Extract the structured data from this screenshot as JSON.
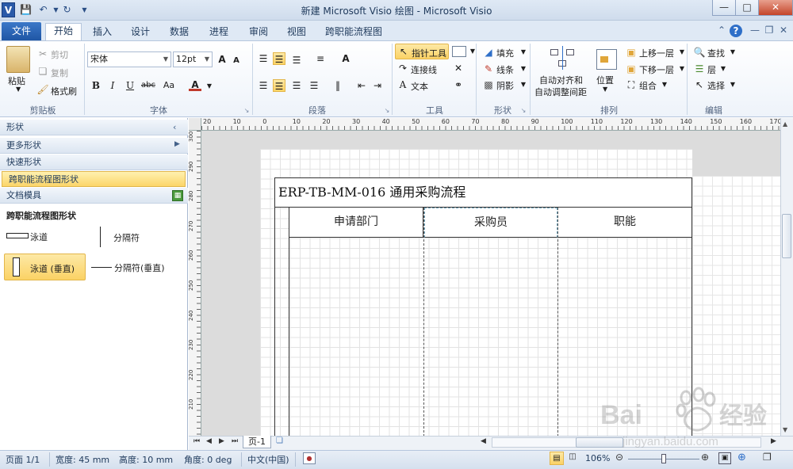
{
  "window": {
    "title": "新建 Microsoft Visio 绘图 - Microsoft Visio",
    "app_icon": "V"
  },
  "tabs": {
    "file": "文件",
    "items": [
      "开始",
      "插入",
      "设计",
      "数据",
      "进程",
      "审阅",
      "视图",
      "跨职能流程图"
    ],
    "active": "开始"
  },
  "ribbon": {
    "clipboard": {
      "label": "剪贴板",
      "paste": "粘贴",
      "cut": "剪切",
      "copy": "复制",
      "format_painter": "格式刷"
    },
    "font": {
      "label": "字体",
      "family": "宋体",
      "size": "12pt",
      "bold": "B",
      "italic": "I",
      "underline": "U",
      "strike": "abc",
      "case": "Aa",
      "color_glyph": "A"
    },
    "paragraph": {
      "label": "段落"
    },
    "tools": {
      "label": "工具",
      "pointer": "指针工具",
      "connector": "连接线",
      "text": "文本"
    },
    "shape": {
      "label": "形状",
      "fill": "填充",
      "line": "线条",
      "shadow": "阴影"
    },
    "arrange": {
      "label": "排列",
      "auto_align": "自动对齐和",
      "auto_space": "自动调整间距",
      "position": "位置",
      "bring_forward": "上移一层",
      "send_backward": "下移一层",
      "group": "组合"
    },
    "editing": {
      "label": "编辑",
      "find": "查找",
      "layer": "层",
      "select": "选择"
    }
  },
  "shapes_panel": {
    "title": "形状",
    "more_shapes": "更多形状",
    "quick_shapes": "快速形状",
    "stencil_active": "跨职能流程图形状",
    "document_stencil": "文档模具",
    "section_title": "跨职能流程图形状",
    "items": [
      {
        "label": "泳道"
      },
      {
        "label": "分隔符"
      },
      {
        "label": "泳道 (垂直)"
      },
      {
        "label": "分隔符(垂直)"
      }
    ]
  },
  "ruler": {
    "h_ticks": [
      "20",
      "10",
      "0",
      "10",
      "20",
      "30",
      "40",
      "50",
      "60",
      "70",
      "80",
      "90",
      "100",
      "110",
      "120",
      "130",
      "140",
      "150",
      "160",
      "170"
    ],
    "v_ticks": [
      "300",
      "290",
      "280",
      "270",
      "260",
      "250",
      "240",
      "230",
      "220",
      "210"
    ]
  },
  "diagram": {
    "title": "ERP-TB-MM-016  通用采购流程",
    "lanes": [
      "申请部门",
      "采购员",
      "职能"
    ]
  },
  "pages": {
    "current": "页-1"
  },
  "statusbar": {
    "page": "页面 1/1",
    "width": "宽度: 45 mm",
    "height": "高度: 10 mm",
    "angle": "角度: 0 deg",
    "language": "中文(中国)",
    "zoom": "106%"
  },
  "watermark": {
    "brand": "Baidu经验",
    "url": "jingyan.baidu.com"
  }
}
